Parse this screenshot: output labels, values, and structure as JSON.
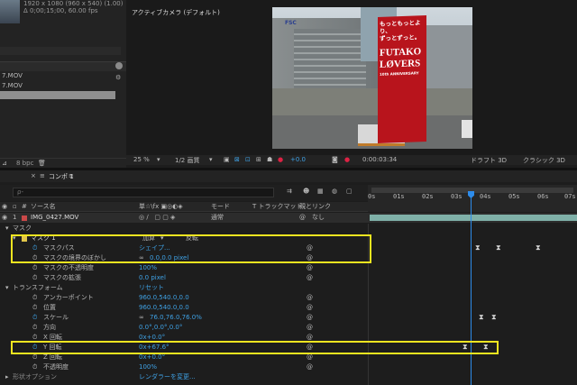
{
  "project": {
    "footage_info": "1920 x 1080 (960 x 540) (1.00)",
    "footage_info2": "Δ 0;00;15;00, 60.00 fps",
    "items": [
      "7.MOV",
      "7.MOV"
    ],
    "bpc": "8 bpc"
  },
  "viewer": {
    "camera_label": "アクティブカメラ (デフォルト)",
    "sign_lines": [
      "もっともっとより、",
      "ずっとずっと。",
      "FUTAKO",
      "LØVERS",
      "10th ANNIVERSARY"
    ],
    "building_sign": "FSC"
  },
  "viewer_toolbar": {
    "zoom": "25 %",
    "resolution": "1/2 画質",
    "exposure": "+0.0",
    "timecode": "0:00:03:34",
    "renderer": "ドラフト 3D",
    "renderer_mode": "クラシック 3D"
  },
  "timeline": {
    "tab_label": "コンポ 1",
    "search_placeholder": "ρ-",
    "columns": {
      "source_name": "ソース名",
      "switches": "単☆\\fx ▣◎◐◈",
      "mode": "モード",
      "trkmat": "T  トラックマット",
      "parent": "親とリンク"
    },
    "ruler": [
      "0s",
      "01s",
      "02s",
      "03s",
      "04s",
      "05s",
      "06s",
      "07s"
    ],
    "layer": {
      "index": "1",
      "name": "IMG_0427.MOV",
      "mode": "通常",
      "parent": "なし"
    },
    "rows": {
      "mask_group": "マスク",
      "mask1": "マスク 1",
      "mask1_mode": "加算",
      "mask1_invert": "反転",
      "mask_path": "マスクパス",
      "mask_path_val": "シェイプ...",
      "mask_feather": "マスクの境界のぼかし",
      "mask_feather_val": "0.0,0.0 pixel",
      "mask_opacity": "マスクの不透明度",
      "mask_opacity_val": "100%",
      "mask_expansion": "マスクの拡張",
      "mask_expansion_val": "0.0 pixel",
      "transform": "トランスフォーム",
      "transform_reset": "リセット",
      "anchor": "アンカーポイント",
      "anchor_val": "960.0,540.0,0.0",
      "position": "位置",
      "position_val": "960.0,540.0,0.0",
      "scale": "スケール",
      "scale_val": "76.0,76.0,76.0%",
      "orientation": "方向",
      "orientation_val": "0.0°,0.0°,0.0°",
      "xrot": "X 回転",
      "xrot_val": "0x+0.0°",
      "yrot": "Y 回転",
      "yrot_val": "0x+67.6°",
      "zrot": "Z 回転",
      "zrot_val": "0x+0.0°",
      "opacity": "不透明度",
      "opacity_val": "100%",
      "material": "形状オプション",
      "material_val": "レンダラーを変更..."
    }
  },
  "colors": {
    "accent_blue": "#3fa1e4",
    "highlight_yellow": "#f2e520",
    "playhead": "#2d8ceb"
  }
}
